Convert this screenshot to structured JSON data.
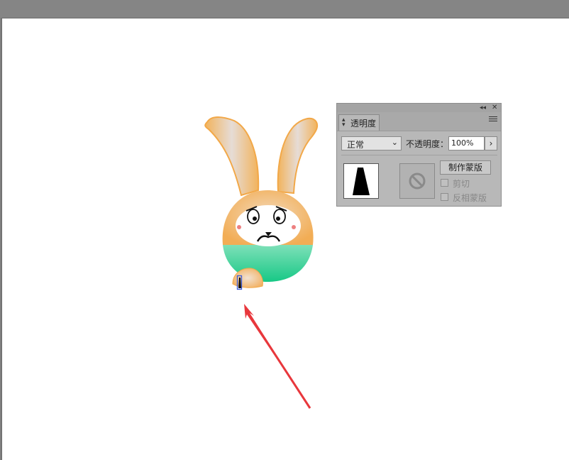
{
  "panel": {
    "collapse_icon": "double-chevron-left-icon",
    "close_icon": "close-icon",
    "tab_label": "透明度",
    "blend_mode": "正常",
    "opacity_label": "不透明度：",
    "opacity_value": "100%",
    "make_mask_label": "制作蒙版",
    "clip_label": "剪切",
    "invert_mask_label": "反相蒙版"
  },
  "colors": {
    "canvas": "#ffffff",
    "panel_bg": "#b8b8b8",
    "bunny_orange": "#f2b35c",
    "bunny_green": "#2bd69a",
    "arrow_red": "#e8373c"
  }
}
